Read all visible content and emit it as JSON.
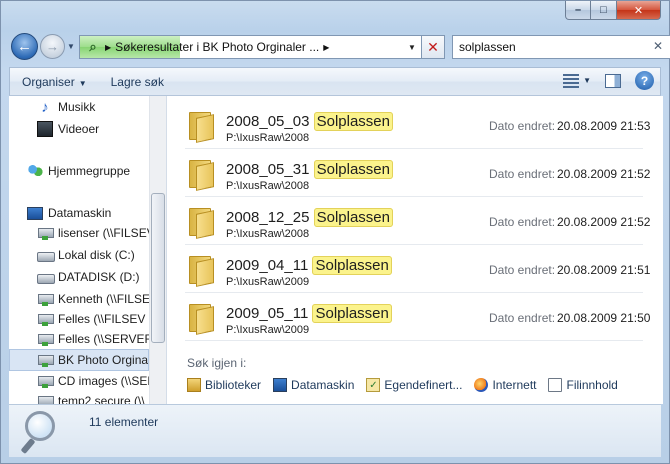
{
  "window": {
    "caption_buttons": {
      "minimize": "–",
      "maximize": "□",
      "close": "✕"
    }
  },
  "nav": {
    "back_glyph": "←",
    "forward_glyph": "→",
    "address_text": "Søkeresultater i BK Photo Orginaler ...",
    "search_value": "solplassen",
    "search_clear": "✕"
  },
  "toolbar": {
    "organize_label": "Organiser",
    "save_search_label": "Lagre søk",
    "help_glyph": "?"
  },
  "sidebar": {
    "items": [
      {
        "label": "Musikk",
        "icon": "music-icon"
      },
      {
        "label": "Videoer",
        "icon": "video-icon"
      },
      {
        "label": "Hjemmegruppe",
        "icon": "homegroup-icon"
      },
      {
        "label": "Datamaskin",
        "icon": "computer-icon"
      },
      {
        "label": "lisenser (\\\\FILSEV",
        "icon": "network-drive-icon"
      },
      {
        "label": "Lokal disk (C:)",
        "icon": "disk-icon"
      },
      {
        "label": "DATADISK (D:)",
        "icon": "disk-icon"
      },
      {
        "label": "Kenneth (\\\\FILSE",
        "icon": "network-drive-icon"
      },
      {
        "label": "Felles (\\\\FILSEV",
        "icon": "network-drive-icon"
      },
      {
        "label": "Felles (\\\\SERVER1",
        "icon": "network-drive-icon"
      },
      {
        "label": "BK Photo Orgina",
        "icon": "network-drive-icon",
        "selected": true
      },
      {
        "label": "CD images (\\\\SEF",
        "icon": "network-drive-icon"
      },
      {
        "label": "temp2 secure (\\\\",
        "icon": "network-drive-icon"
      }
    ]
  },
  "results": {
    "date_label": "Dato endret:",
    "items": [
      {
        "prefix": "2008_05_03",
        "highlight": "Solplassen",
        "path": "P:\\IxusRaw\\2008",
        "date": "20.08.2009 21:53"
      },
      {
        "prefix": "2008_05_31",
        "highlight": "Solplassen",
        "path": "P:\\IxusRaw\\2008",
        "date": "20.08.2009 21:52"
      },
      {
        "prefix": "2008_12_25",
        "highlight": "Solplassen",
        "path": "P:\\IxusRaw\\2008",
        "date": "20.08.2009 21:52"
      },
      {
        "prefix": "2009_04_11",
        "highlight": "Solplassen",
        "path": "P:\\IxusRaw\\2009",
        "date": "20.08.2009 21:51"
      },
      {
        "prefix": "2009_05_11",
        "highlight": "Solplassen",
        "path": "P:\\IxusRaw\\2009",
        "date": "20.08.2009 21:50"
      }
    ]
  },
  "search_again": {
    "label": "Søk igjen i:",
    "options": [
      "Biblioteker",
      "Datamaskin",
      "Egendefinert...",
      "Internett",
      "Filinnhold"
    ]
  },
  "status": {
    "count_text": "11 elementer"
  }
}
